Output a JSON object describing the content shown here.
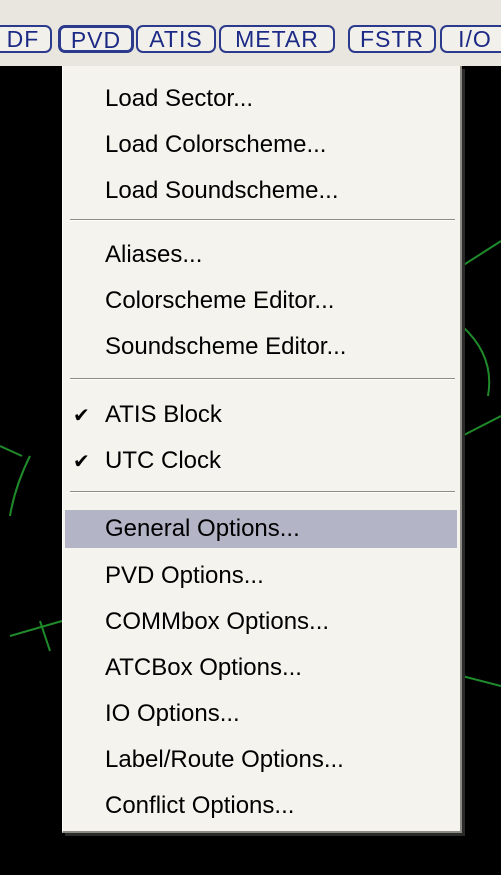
{
  "toolbar": {
    "buttons": [
      "DF",
      "PVD",
      "ATIS",
      "METAR",
      "FSTR",
      "I/O"
    ]
  },
  "menu": {
    "group1": [
      "Load Sector...",
      "Load Colorscheme...",
      "Load Soundscheme..."
    ],
    "group2": [
      "Aliases...",
      "Colorscheme Editor...",
      "Soundscheme Editor..."
    ],
    "group3": [
      "ATIS Block",
      "UTC Clock"
    ],
    "checkmark": "✔",
    "group4": [
      "General Options...",
      "PVD Options...",
      "COMMbox Options...",
      "ATCBox Options...",
      "IO Options...",
      "Label/Route Options...",
      "Conflict Options..."
    ],
    "highlighted_item": "General Options..."
  },
  "colors": {
    "toolbar_bg": "#e8e6de",
    "button_text": "#1c2a86",
    "menu_bg": "#f4f3ee",
    "highlight": "#b3b4c6",
    "scope_bg": "#000000",
    "scope_lines": "#1f8a2a"
  }
}
